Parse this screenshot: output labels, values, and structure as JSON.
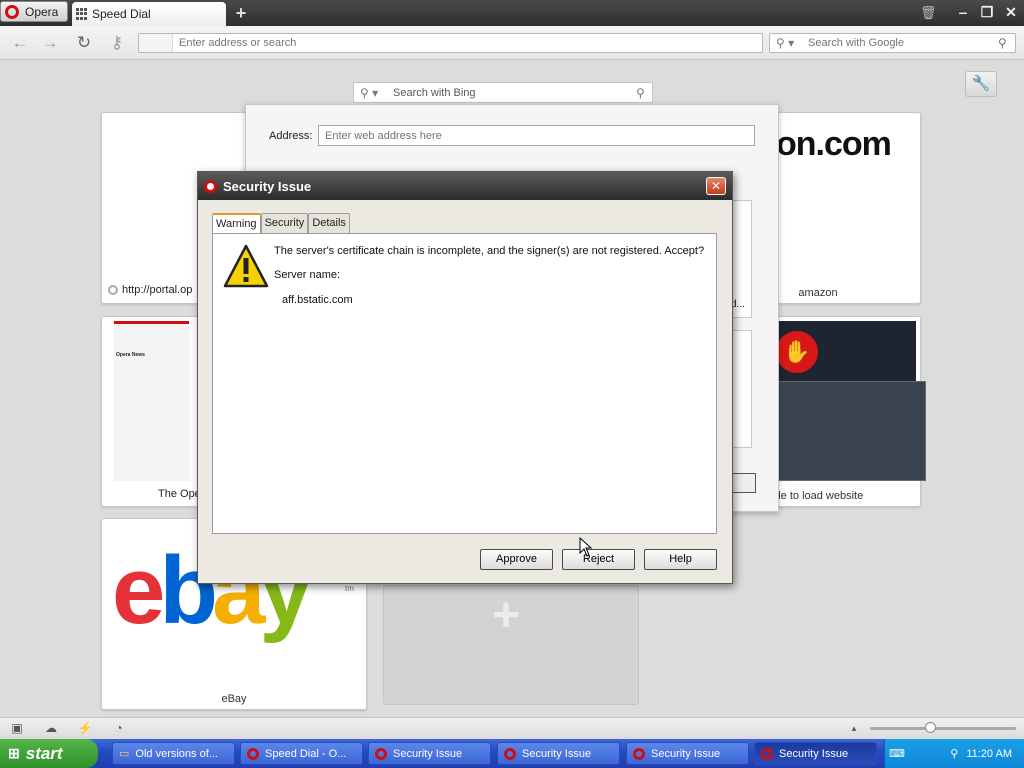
{
  "browser": {
    "menu_label": "Opera",
    "tab_title": "Speed Dial",
    "address_placeholder": "Enter address or search",
    "search_placeholder": "Search with Google"
  },
  "speed_dial": {
    "bing_placeholder": "Search with Bing",
    "tiles": [
      {
        "caption": "http://portal.op",
        "kind": "link"
      },
      {
        "caption": "amazon",
        "logo": "on.com"
      },
      {
        "caption": "The Ope",
        "thumb_title": "Opera News"
      },
      {
        "caption": "able to load website"
      },
      {
        "caption": "eBay"
      }
    ],
    "partial_caption": "d..."
  },
  "add_panel": {
    "address_label": "Address:",
    "address_placeholder": "Enter web address here"
  },
  "dialog": {
    "title": "Security Issue",
    "tabs": [
      "Warning",
      "Security",
      "Details"
    ],
    "message": "The server's certificate chain is incomplete, and the signer(s) are not registered. Accept?",
    "server_label": "Server name:",
    "server_value": "aff.bstatic.com",
    "buttons": {
      "approve": "Approve",
      "reject": "Reject",
      "help": "Help"
    }
  },
  "taskbar": {
    "start_label": "start",
    "items": [
      {
        "label": "Old versions of...",
        "icon": "folder-icon"
      },
      {
        "label": "Speed Dial - O...",
        "icon": "opera-icon"
      },
      {
        "label": "Security Issue",
        "icon": "opera-icon"
      },
      {
        "label": "Security Issue",
        "icon": "opera-icon"
      },
      {
        "label": "Security Issue",
        "icon": "opera-icon"
      },
      {
        "label": "Security Issue",
        "icon": "opera-icon",
        "active": true
      }
    ],
    "clock": "11:20 AM"
  },
  "colors": {
    "opera_red": "#d10d0d",
    "taskbar_blue": "#2449c2",
    "start_green": "#3a9a33",
    "ebay_red": "#e53238",
    "ebay_blue": "#0064d2",
    "ebay_yellow": "#f5af02",
    "ebay_green": "#86b817"
  }
}
